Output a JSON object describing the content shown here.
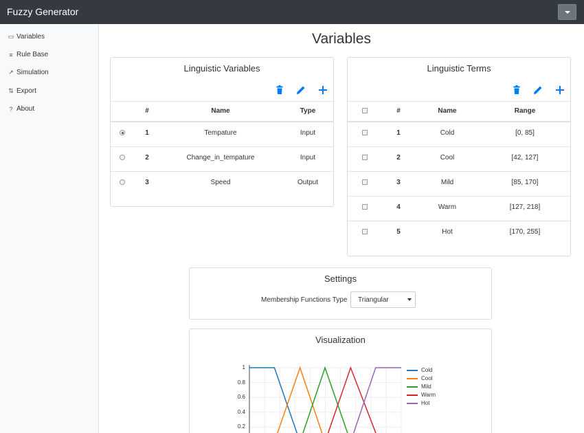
{
  "app": {
    "brand": "Fuzzy Generator"
  },
  "sidebar": {
    "items": [
      {
        "label": "Variables",
        "icon": "variables-icon",
        "glyph": "▭"
      },
      {
        "label": "Rule Base",
        "icon": "list-icon",
        "glyph": "≡"
      },
      {
        "label": "Simulation",
        "icon": "chart-line-icon",
        "glyph": "↗"
      },
      {
        "label": "Export",
        "icon": "sort-icon",
        "glyph": "⇅"
      },
      {
        "label": "About",
        "icon": "question-circle-icon",
        "glyph": "?"
      }
    ]
  },
  "page": {
    "title": "Variables"
  },
  "variables_card": {
    "title": "Linguistic Variables",
    "headers": {
      "num": "#",
      "name": "Name",
      "type": "Type"
    },
    "rows": [
      {
        "num": "1",
        "name": "Tempature",
        "type": "Input",
        "selected": true
      },
      {
        "num": "2",
        "name": "Change_in_tempature",
        "type": "Input",
        "selected": false
      },
      {
        "num": "3",
        "name": "Speed",
        "type": "Output",
        "selected": false
      }
    ]
  },
  "terms_card": {
    "title": "Linguistic Terms",
    "headers": {
      "num": "#",
      "name": "Name",
      "range": "Range"
    },
    "rows": [
      {
        "num": "1",
        "name": "Cold",
        "range": "[0, 85]"
      },
      {
        "num": "2",
        "name": "Cool",
        "range": "[42, 127]"
      },
      {
        "num": "3",
        "name": "Mild",
        "range": "[85, 170]"
      },
      {
        "num": "4",
        "name": "Warm",
        "range": "[127, 218]"
      },
      {
        "num": "5",
        "name": "Hot",
        "range": "[170, 255]"
      }
    ]
  },
  "settings_card": {
    "title": "Settings",
    "mf_label": "Membership Functions Type",
    "mf_value": "Triangular"
  },
  "visualization_card": {
    "title": "Visualization"
  },
  "colors": {
    "accent": "#007bff",
    "navbar": "#343a40"
  },
  "chart_data": {
    "type": "line",
    "title": "",
    "xlabel": "",
    "ylabel": "",
    "xlim": [
      0,
      255
    ],
    "ylim": [
      0,
      1
    ],
    "yticks": [
      "1",
      "0.8",
      "0.6",
      "0.4",
      "0.2"
    ],
    "grid": true,
    "legend_placement": "right",
    "series": [
      {
        "name": "Cold",
        "color": "#1f77b4",
        "x": [
          0,
          42,
          85
        ],
        "y": [
          1,
          1,
          0
        ]
      },
      {
        "name": "Cool",
        "color": "#ff7f0e",
        "x": [
          42,
          85,
          127
        ],
        "y": [
          0,
          1,
          0
        ]
      },
      {
        "name": "Mild",
        "color": "#2ca02c",
        "x": [
          85,
          127,
          170
        ],
        "y": [
          0,
          1,
          0
        ]
      },
      {
        "name": "Warm",
        "color": "#d62728",
        "x": [
          127,
          170,
          218
        ],
        "y": [
          0,
          1,
          0
        ]
      },
      {
        "name": "Hot",
        "color": "#9467bd",
        "x": [
          170,
          212,
          255
        ],
        "y": [
          0,
          1,
          1
        ]
      }
    ]
  }
}
